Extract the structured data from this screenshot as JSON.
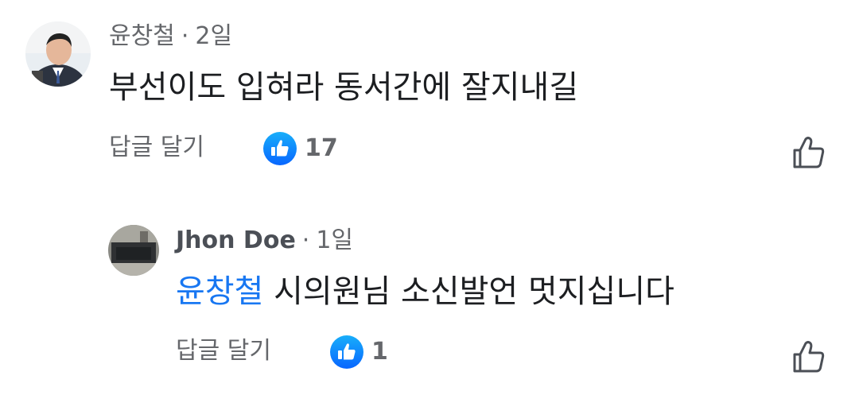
{
  "comments": [
    {
      "author": "윤창철",
      "time": "2일",
      "text": "부선이도 입혀라 동서간에 잘지내길",
      "reply_label": "답글 달기",
      "like_count": "17"
    }
  ],
  "replies": [
    {
      "author": "Jhon Doe",
      "time": "1일",
      "mention": "윤창철",
      "text": " 시의원님 소신발언 멋지십니다",
      "reply_label": "답글 달기",
      "like_count": "1"
    }
  ],
  "separator": "·",
  "colors": {
    "accent": "#1877f2",
    "muted": "#65676b",
    "text": "#1c1e21"
  },
  "icons": [
    "avatar",
    "like-reaction-icon",
    "like-outline-icon"
  ]
}
